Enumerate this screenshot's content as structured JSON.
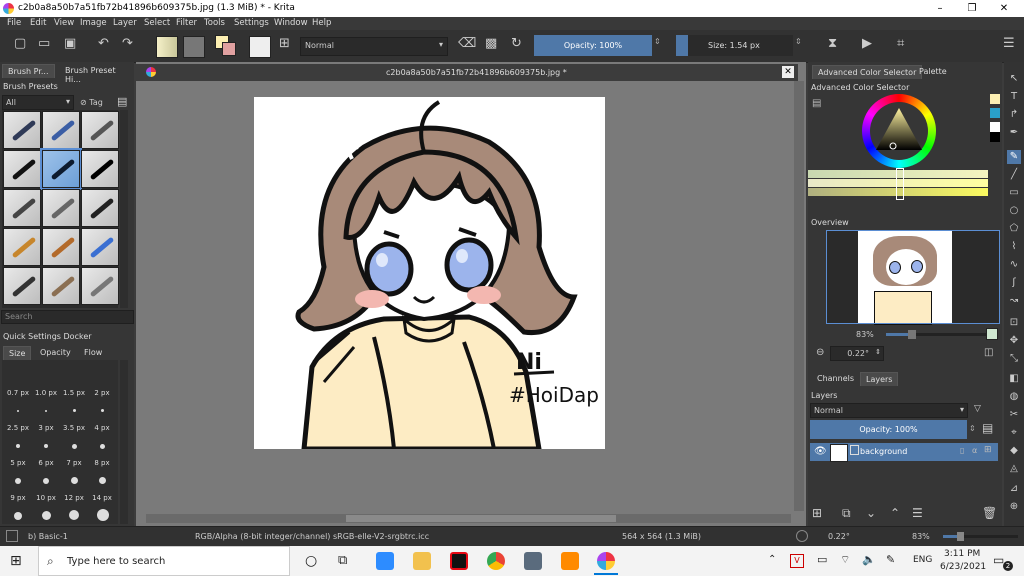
{
  "window": {
    "title": "c2b0a8a50b7a51fb72b41896b609375b.jpg (1.3 MiB) * - Krita",
    "controls": [
      "–",
      "❐",
      "✕"
    ]
  },
  "menu": [
    "File",
    "Edit",
    "View",
    "Image",
    "Layer",
    "Select",
    "Filter",
    "Tools",
    "Settings",
    "Window",
    "Help"
  ],
  "toolbar": {
    "blend_mode": "Normal",
    "opacity": "Opacity: 100%",
    "size": "Size: 1.54 px"
  },
  "left_dock": {
    "tabs": [
      "Brush Pr...",
      "Brush Preset Hi..."
    ],
    "brush_presets_title": "Brush Presets",
    "filter_value": "All",
    "tag_label": "Tag",
    "search_placeholder": "Search",
    "quick_settings_title": "Quick Settings Docker",
    "qs_tabs": [
      "Size",
      "Opacity",
      "Flow"
    ],
    "sizes": [
      "0.7 px",
      "1.0 px",
      "1.5 px",
      "2 px",
      "2.5 px",
      "3 px",
      "3.5 px",
      "4 px",
      "5 px",
      "6 px",
      "7 px",
      "8 px",
      "9 px",
      "10 px",
      "12 px",
      "14 px"
    ]
  },
  "document": {
    "tab_title": "c2b0a8a50b7a51fb72b41896b609375b.jpg *",
    "signature_text": "Ni",
    "hashtag_text": "#HoiDap"
  },
  "right_dock": {
    "tabs": [
      "Advanced Color Selector",
      "Palette"
    ],
    "color_selector_title": "Advanced Color Selector",
    "overview_title": "Overview",
    "zoom_value": "83%",
    "rotation_value": "0.22°",
    "channel_tabs": [
      "Channels",
      "Layers"
    ],
    "layers_title": "Layers",
    "layer_blend": "Normal",
    "layer_opacity": "Opacity: 100%",
    "layer_name": "background"
  },
  "statusbar": {
    "brush": "b) Basic-1",
    "color_info": "RGB/Alpha (8-bit integer/channel) sRGB-elle-V2-srgbtrc.icc",
    "dimensions": "564 x 564 (1.3 MiB)",
    "rotation": "0.22°",
    "zoom": "83%"
  },
  "taskbar": {
    "search_placeholder": "Type here to search",
    "language": "ENG",
    "time": "3:11 PM",
    "date": "6/23/2021",
    "notification_count": "2"
  },
  "colors": {
    "accent": "#4f78a8",
    "canvas_bg": "#7a7a7a",
    "hair": "#a88a79",
    "sweater": "#fdecc4",
    "eyes": "#9cb4ec"
  }
}
